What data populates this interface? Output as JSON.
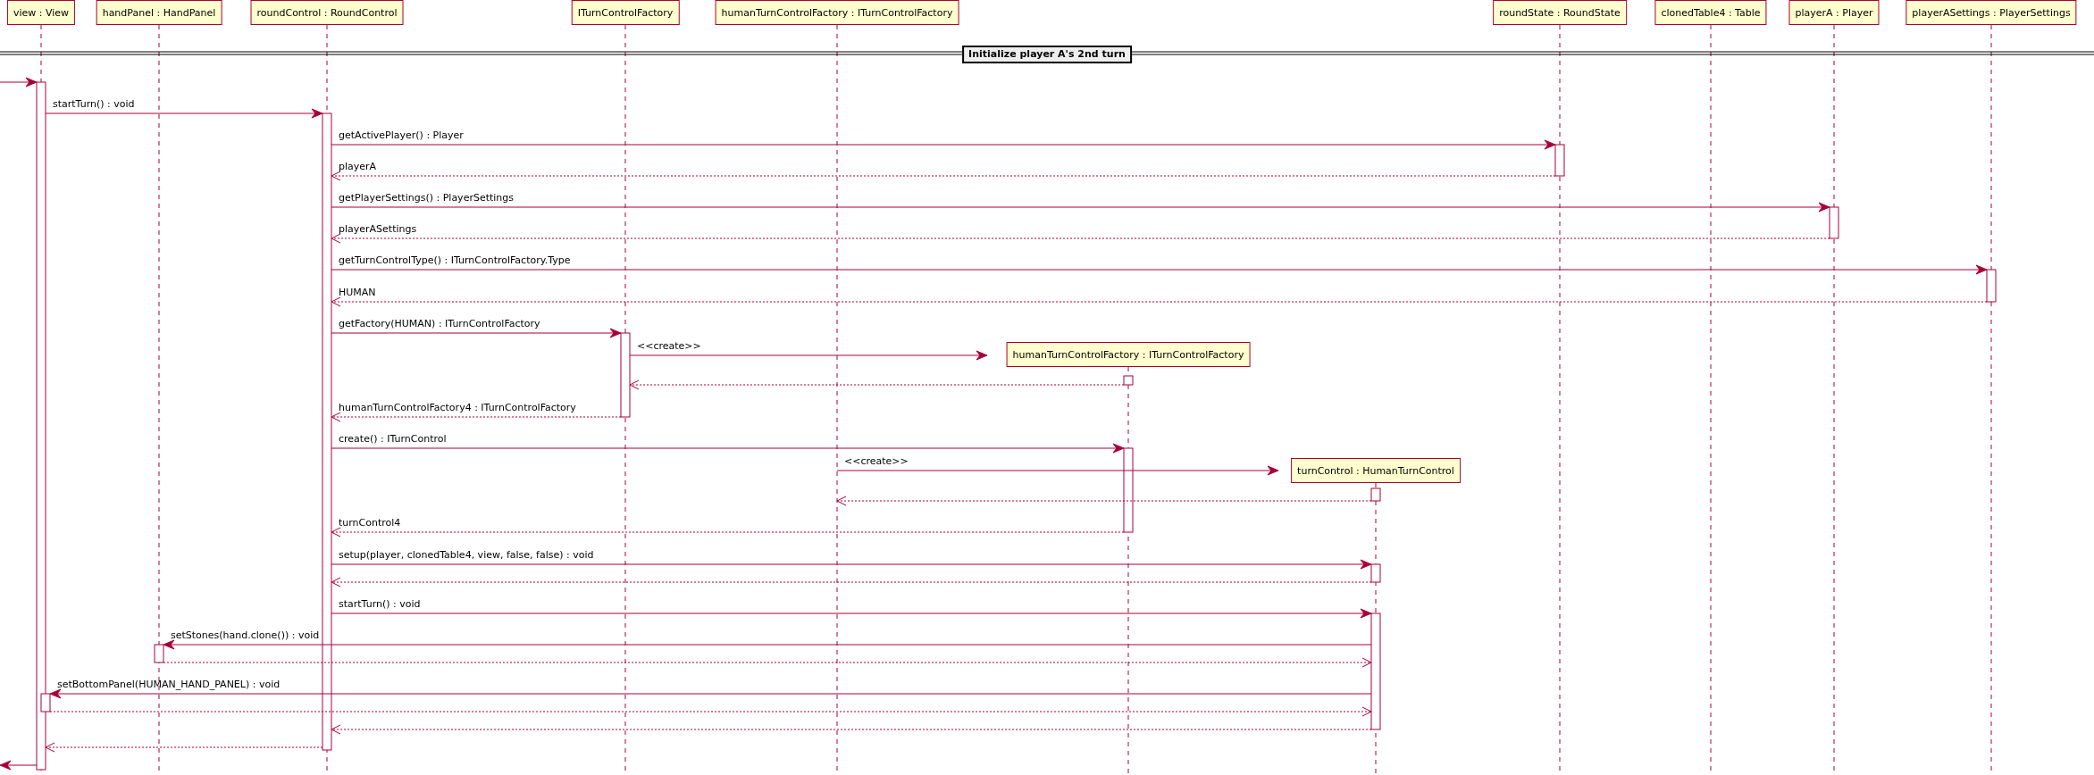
{
  "participants": [
    {
      "label": "view : View"
    },
    {
      "label": "handPanel : HandPanel"
    },
    {
      "label": "roundControl : RoundControl"
    },
    {
      "label": "ITurnControlFactory"
    },
    {
      "label": "humanTurnControlFactory : ITurnControlFactory"
    },
    {
      "label": "roundState : RoundState"
    },
    {
      "label": "clonedTable4 : Table"
    },
    {
      "label": "playerA : Player"
    },
    {
      "label": "playerASettings : PlayerSettings"
    }
  ],
  "created_participants": [
    {
      "label": "humanTurnControlFactory : ITurnControlFactory"
    },
    {
      "label": "turnControl : HumanTurnControl"
    }
  ],
  "frame": {
    "title": "Initialize player A's 2nd turn"
  },
  "messages": [
    {
      "kind": "call"
    },
    {
      "kind": "call",
      "label": "startTurn() : void"
    },
    {
      "kind": "call",
      "label": "getActivePlayer() : Player"
    },
    {
      "kind": "return",
      "label": "playerA"
    },
    {
      "kind": "call",
      "label": "getPlayerSettings() : PlayerSettings"
    },
    {
      "kind": "return",
      "label": "playerASettings"
    },
    {
      "kind": "call",
      "label": "getTurnControlType() : ITurnControlFactory.Type"
    },
    {
      "kind": "return",
      "label": "HUMAN"
    },
    {
      "kind": "call",
      "label": "getFactory(HUMAN) : ITurnControlFactory"
    },
    {
      "kind": "call",
      "label": "<<create>>"
    },
    {
      "kind": "return"
    },
    {
      "kind": "return",
      "label": "humanTurnControlFactory4 : ITurnControlFactory"
    },
    {
      "kind": "call",
      "label": "create() : ITurnControl"
    },
    {
      "kind": "call",
      "label": "<<create>>"
    },
    {
      "kind": "return"
    },
    {
      "kind": "return",
      "label": "turnControl4"
    },
    {
      "kind": "call",
      "label": "setup(player, clonedTable4, view, false, false) : void"
    },
    {
      "kind": "return"
    },
    {
      "kind": "call",
      "label": "startTurn() : void"
    },
    {
      "kind": "call",
      "label": "setStones(hand.clone()) : void"
    },
    {
      "kind": "return"
    },
    {
      "kind": "call",
      "label": "setBottomPanel(HUMAN_HAND_PANEL) : void"
    },
    {
      "kind": "return"
    },
    {
      "kind": "return"
    },
    {
      "kind": "return"
    },
    {
      "kind": "call"
    }
  ]
}
